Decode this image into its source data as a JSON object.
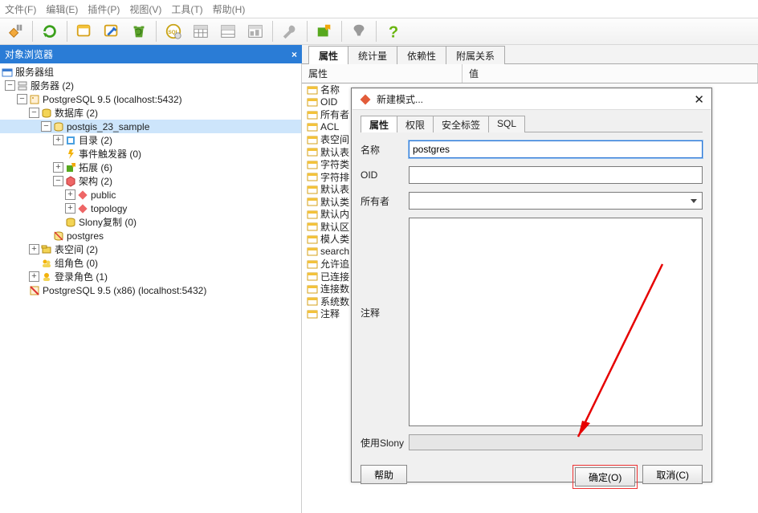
{
  "menu": {
    "items": [
      "文件(F)",
      "编辑(E)",
      "插件(P)",
      "视图(V)",
      "工具(T)",
      "帮助(H)"
    ]
  },
  "toolbar_icons": [
    "plug",
    "refresh",
    "new-window",
    "sql-editor",
    "trash",
    "terminal",
    "sql-query",
    "grid",
    "table",
    "copy",
    "wrench",
    "plugin",
    "spacer",
    "filter",
    "help"
  ],
  "browser": {
    "title": "对象浏览器",
    "tree": {
      "root": "服务器组",
      "servers_label": "服务器 (2)",
      "pg95": "PostgreSQL 9.5 (localhost:5432)",
      "databases": "数据库 (2)",
      "db_sample": "postgis_23_sample",
      "catalogs": "目录  (2)",
      "event_triggers": "事件触发器 (0)",
      "extensions": "拓展 (6)",
      "schemas": "架构 (2)",
      "schema_public": "public",
      "schema_topology": "topology",
      "slony": "Slony复制 (0)",
      "db_postgres": "postgres",
      "tablespaces": "表空间 (2)",
      "group_roles": "组角色 (0)",
      "login_roles": "登录角色 (1)",
      "pg95_x86": "PostgreSQL 9.5 (x86) (localhost:5432)"
    }
  },
  "right_tabs": [
    "属性",
    "统计量",
    "依赖性",
    "附属关系"
  ],
  "prop_header_left": "属性",
  "prop_header_right": "值",
  "prop_rows": [
    "名称",
    "OID",
    "所有者",
    "ACL",
    "表空间",
    "默认表",
    "字符类",
    "字符排",
    "默认表",
    "默认类",
    "默认内",
    "默认区",
    "模人类",
    "search",
    "允许追",
    "已连接",
    "连接数",
    "系统数",
    "注释"
  ],
  "dialog": {
    "title": "新建模式...",
    "tabs": [
      "属性",
      "权限",
      "安全标签",
      "SQL"
    ],
    "fields": {
      "name_label": "名称",
      "name_value": "postgres",
      "oid_label": "OID",
      "owner_label": "所有者",
      "comment_label": "注释",
      "slony_label": "使用Slony"
    },
    "buttons": {
      "help": "帮助",
      "ok": "确定(O)",
      "cancel": "取消(C)"
    }
  }
}
